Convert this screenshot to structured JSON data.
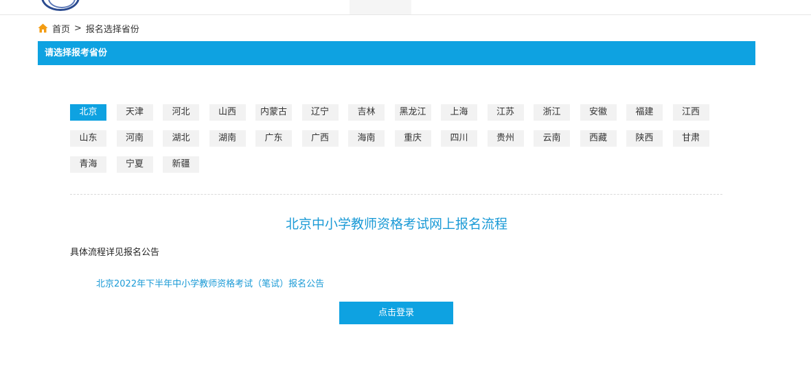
{
  "breadcrumb": {
    "home": "首页",
    "separator": ">",
    "current": "报名选择省份",
    "icon": "home-icon",
    "icon_color": "#f39c12"
  },
  "section_header": {
    "title": "请选择报考省份",
    "color": "#0ea2e1"
  },
  "provinces": [
    {
      "label": "北京",
      "active": true
    },
    {
      "label": "天津"
    },
    {
      "label": "河北"
    },
    {
      "label": "山西"
    },
    {
      "label": "内蒙古"
    },
    {
      "label": "辽宁"
    },
    {
      "label": "吉林"
    },
    {
      "label": "黑龙江"
    },
    {
      "label": "上海"
    },
    {
      "label": "江苏"
    },
    {
      "label": "浙江"
    },
    {
      "label": "安徽"
    },
    {
      "label": "福建"
    },
    {
      "label": "江西"
    },
    {
      "label": "山东"
    },
    {
      "label": "河南"
    },
    {
      "label": "湖北"
    },
    {
      "label": "湖南"
    },
    {
      "label": "广东"
    },
    {
      "label": "广西"
    },
    {
      "label": "海南"
    },
    {
      "label": "重庆"
    },
    {
      "label": "四川"
    },
    {
      "label": "贵州"
    },
    {
      "label": "云南"
    },
    {
      "label": "西藏"
    },
    {
      "label": "陕西"
    },
    {
      "label": "甘肃"
    },
    {
      "label": "青海"
    },
    {
      "label": "宁夏"
    },
    {
      "label": "新疆"
    }
  ],
  "flow": {
    "title": "北京中小学教师资格考试网上报名流程",
    "description": "具体流程详见报名公告",
    "notice_link": "北京2022年下半年中小学教师资格考试（笔试）报名公告",
    "login_button": "点击登录"
  }
}
